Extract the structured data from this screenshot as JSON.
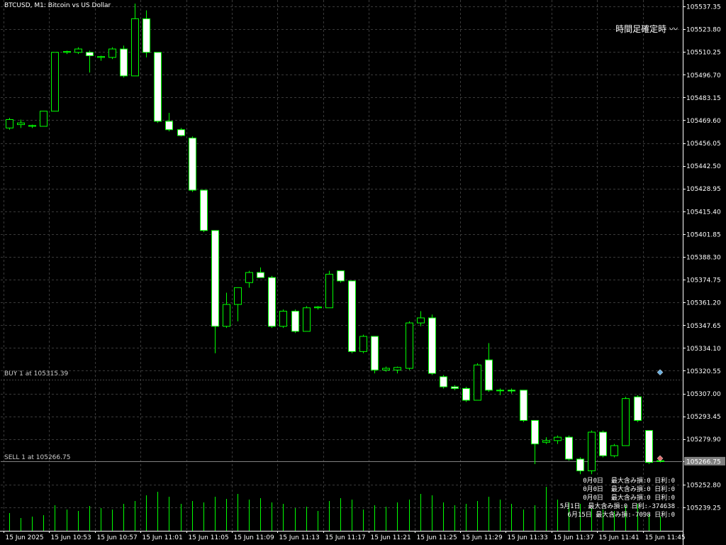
{
  "header": {
    "title": "BTCUSD, M1:  Bitcoin vs US Dollar",
    "indicator_label": "時間足確定時"
  },
  "trades": {
    "buy_label": "BUY 1 at 105315.39",
    "sell_label": "SELL 1 at 105266.75"
  },
  "stats": [
    "0月0日  最大含み損:0 日利:0",
    "0月0日  最大含み損:0 日利:0",
    "0月0日  最大含み損:0 日利:0",
    "5月1日  最大含み損:0 日利:-374638",
    "6月15日 最大含み損:-7098 日利:0"
  ],
  "colors": {
    "background": "#000000",
    "grid": "#3a3a3a",
    "bull": "#00ff00",
    "bear": "#ffffff",
    "wick": "#00ff00",
    "volume": "#00ff00",
    "price_line": "#808080"
  },
  "chart_data": {
    "type": "candlestick",
    "symbol": "BTCUSD",
    "timeframe": "M1",
    "ylim": [
      105233.0,
      105541.0
    ],
    "yticks": [
      105537.35,
      105523.8,
      105510.25,
      105496.7,
      105483.15,
      105469.6,
      105456.05,
      105442.5,
      105428.95,
      105415.4,
      105401.85,
      105388.3,
      105374.75,
      105361.2,
      105347.65,
      105334.1,
      105320.55,
      105307.0,
      105293.45,
      105279.9,
      105266.75,
      105252.8,
      105239.25
    ],
    "current_price": 105266.75,
    "xticks": [
      "15 Jun 2025",
      "15 Jun 10:53",
      "15 Jun 10:57",
      "15 Jun 11:01",
      "15 Jun 11:05",
      "15 Jun 11:09",
      "15 Jun 11:13",
      "15 Jun 11:17",
      "15 Jun 11:21",
      "15 Jun 11:25",
      "15 Jun 11:29",
      "15 Jun 11:33",
      "15 Jun 11:37",
      "15 Jun 11:41",
      "15 Jun 11:45"
    ],
    "candles": [
      {
        "o": 105465.0,
        "h": 105471.0,
        "l": 105464.0,
        "c": 105470.0
      },
      {
        "o": 105467.0,
        "h": 105470.0,
        "l": 105465.0,
        "c": 105468.0
      },
      {
        "o": 105466.0,
        "h": 105467.0,
        "l": 105465.0,
        "c": 105466.5
      },
      {
        "o": 105466.0,
        "h": 105475.0,
        "l": 105466.0,
        "c": 105475.0
      },
      {
        "o": 105475.0,
        "h": 105510.0,
        "l": 105475.0,
        "c": 105510.0
      },
      {
        "o": 105510.0,
        "h": 105511.0,
        "l": 105509.0,
        "c": 105510.5
      },
      {
        "o": 105510.0,
        "h": 105513.0,
        "l": 105509.0,
        "c": 105512.0
      },
      {
        "o": 105510.0,
        "h": 105511.0,
        "l": 105498.0,
        "c": 105508.0
      },
      {
        "o": 105507.0,
        "h": 105508.0,
        "l": 105505.0,
        "c": 105507.5
      },
      {
        "o": 105507.0,
        "h": 105513.0,
        "l": 105506.0,
        "c": 105512.0
      },
      {
        "o": 105512.0,
        "h": 105514.0,
        "l": 105495.0,
        "c": 105496.0
      },
      {
        "o": 105496.0,
        "h": 105539.0,
        "l": 105496.0,
        "c": 105530.0
      },
      {
        "o": 105530.0,
        "h": 105535.0,
        "l": 105507.0,
        "c": 105510.0
      },
      {
        "o": 105510.0,
        "h": 105510.0,
        "l": 105468.0,
        "c": 105469.0
      },
      {
        "o": 105469.0,
        "h": 105474.0,
        "l": 105463.0,
        "c": 105464.0
      },
      {
        "o": 105464.0,
        "h": 105465.0,
        "l": 105460.0,
        "c": 105460.5
      },
      {
        "o": 105459.0,
        "h": 105460.0,
        "l": 105427.0,
        "c": 105428.0
      },
      {
        "o": 105428.0,
        "h": 105428.0,
        "l": 105403.0,
        "c": 105404.0
      },
      {
        "o": 105404.0,
        "h": 105404.0,
        "l": 105331.0,
        "c": 105347.0
      },
      {
        "o": 105347.0,
        "h": 105367.0,
        "l": 105346.0,
        "c": 105360.0
      },
      {
        "o": 105360.0,
        "h": 105370.0,
        "l": 105350.0,
        "c": 105370.0
      },
      {
        "o": 105373.0,
        "h": 105380.0,
        "l": 105370.0,
        "c": 105379.0
      },
      {
        "o": 105379.0,
        "h": 105382.0,
        "l": 105376.0,
        "c": 105376.0
      },
      {
        "o": 105376.0,
        "h": 105377.0,
        "l": 105346.0,
        "c": 105347.0
      },
      {
        "o": 105347.0,
        "h": 105357.0,
        "l": 105346.0,
        "c": 105356.0
      },
      {
        "o": 105356.0,
        "h": 105357.0,
        "l": 105343.0,
        "c": 105344.0
      },
      {
        "o": 105344.0,
        "h": 105359.0,
        "l": 105344.0,
        "c": 105358.0
      },
      {
        "o": 105358.0,
        "h": 105359.0,
        "l": 105357.0,
        "c": 105358.5
      },
      {
        "o": 105358.0,
        "h": 105380.0,
        "l": 105358.0,
        "c": 105378.0
      },
      {
        "o": 105380.0,
        "h": 105380.0,
        "l": 105373.0,
        "c": 105374.0
      },
      {
        "o": 105374.0,
        "h": 105374.0,
        "l": 105331.0,
        "c": 105332.0
      },
      {
        "o": 105332.0,
        "h": 105342.0,
        "l": 105331.0,
        "c": 105341.0
      },
      {
        "o": 105341.0,
        "h": 105341.0,
        "l": 105319.0,
        "c": 105321.0
      },
      {
        "o": 105321.0,
        "h": 105323.0,
        "l": 105320.0,
        "c": 105322.0
      },
      {
        "o": 105321.0,
        "h": 105323.0,
        "l": 105319.0,
        "c": 105322.5
      },
      {
        "o": 105322.0,
        "h": 105350.0,
        "l": 105321.0,
        "c": 105349.0
      },
      {
        "o": 105349.0,
        "h": 105356.0,
        "l": 105347.0,
        "c": 105352.0
      },
      {
        "o": 105352.0,
        "h": 105354.0,
        "l": 105318.0,
        "c": 105319.0
      },
      {
        "o": 105317.0,
        "h": 105318.0,
        "l": 105310.0,
        "c": 105311.0
      },
      {
        "o": 105311.0,
        "h": 105312.0,
        "l": 105309.0,
        "c": 105310.0
      },
      {
        "o": 105310.0,
        "h": 105311.0,
        "l": 105302.0,
        "c": 105303.0
      },
      {
        "o": 105303.0,
        "h": 105325.0,
        "l": 105303.0,
        "c": 105324.0
      },
      {
        "o": 105327.0,
        "h": 105337.0,
        "l": 105308.0,
        "c": 105309.0
      },
      {
        "o": 105309.0,
        "h": 105310.0,
        "l": 105306.0,
        "c": 105309.0
      },
      {
        "o": 105309.0,
        "h": 105310.0,
        "l": 105307.0,
        "c": 105308.5
      },
      {
        "o": 105309.0,
        "h": 105309.0,
        "l": 105290.0,
        "c": 105291.0
      },
      {
        "o": 105291.0,
        "h": 105291.0,
        "l": 105265.0,
        "c": 105277.0
      },
      {
        "o": 105278.0,
        "h": 105281.0,
        "l": 105277.0,
        "c": 105279.0
      },
      {
        "o": 105279.0,
        "h": 105282.0,
        "l": 105277.0,
        "c": 105281.0
      },
      {
        "o": 105281.0,
        "h": 105282.0,
        "l": 105267.0,
        "c": 105268.0
      },
      {
        "o": 105268.0,
        "h": 105269.0,
        "l": 105259.0,
        "c": 105261.0
      },
      {
        "o": 105261.0,
        "h": 105285.0,
        "l": 105259.0,
        "c": 105284.0
      },
      {
        "o": 105284.0,
        "h": 105285.0,
        "l": 105269.0,
        "c": 105270.0
      },
      {
        "o": 105270.0,
        "h": 105277.0,
        "l": 105269.0,
        "c": 105276.0
      },
      {
        "o": 105276.0,
        "h": 105305.0,
        "l": 105276.0,
        "c": 105304.0
      },
      {
        "o": 105305.0,
        "h": 105306.0,
        "l": 105290.0,
        "c": 105291.0
      },
      {
        "o": 105285.0,
        "h": 105285.0,
        "l": 105265.0,
        "c": 105266.0
      },
      {
        "o": 105267.0,
        "h": 105268.0,
        "l": 105266.0,
        "c": 105266.75
      }
    ],
    "volume": [
      25,
      18,
      20,
      22,
      36,
      30,
      28,
      35,
      32,
      30,
      38,
      42,
      50,
      55,
      48,
      38,
      42,
      40,
      48,
      45,
      52,
      44,
      46,
      40,
      38,
      32,
      34,
      28,
      42,
      46,
      44,
      30,
      36,
      34,
      40,
      44,
      52,
      50,
      40,
      36,
      38,
      42,
      48,
      44,
      38,
      30,
      36,
      62,
      44,
      40,
      38,
      32,
      30,
      28,
      36,
      38,
      24,
      20
    ],
    "markers": [
      {
        "type": "buy",
        "price": 105315.39,
        "bar": 57
      },
      {
        "type": "sell",
        "price": 105266.75,
        "bar": 57
      }
    ]
  }
}
